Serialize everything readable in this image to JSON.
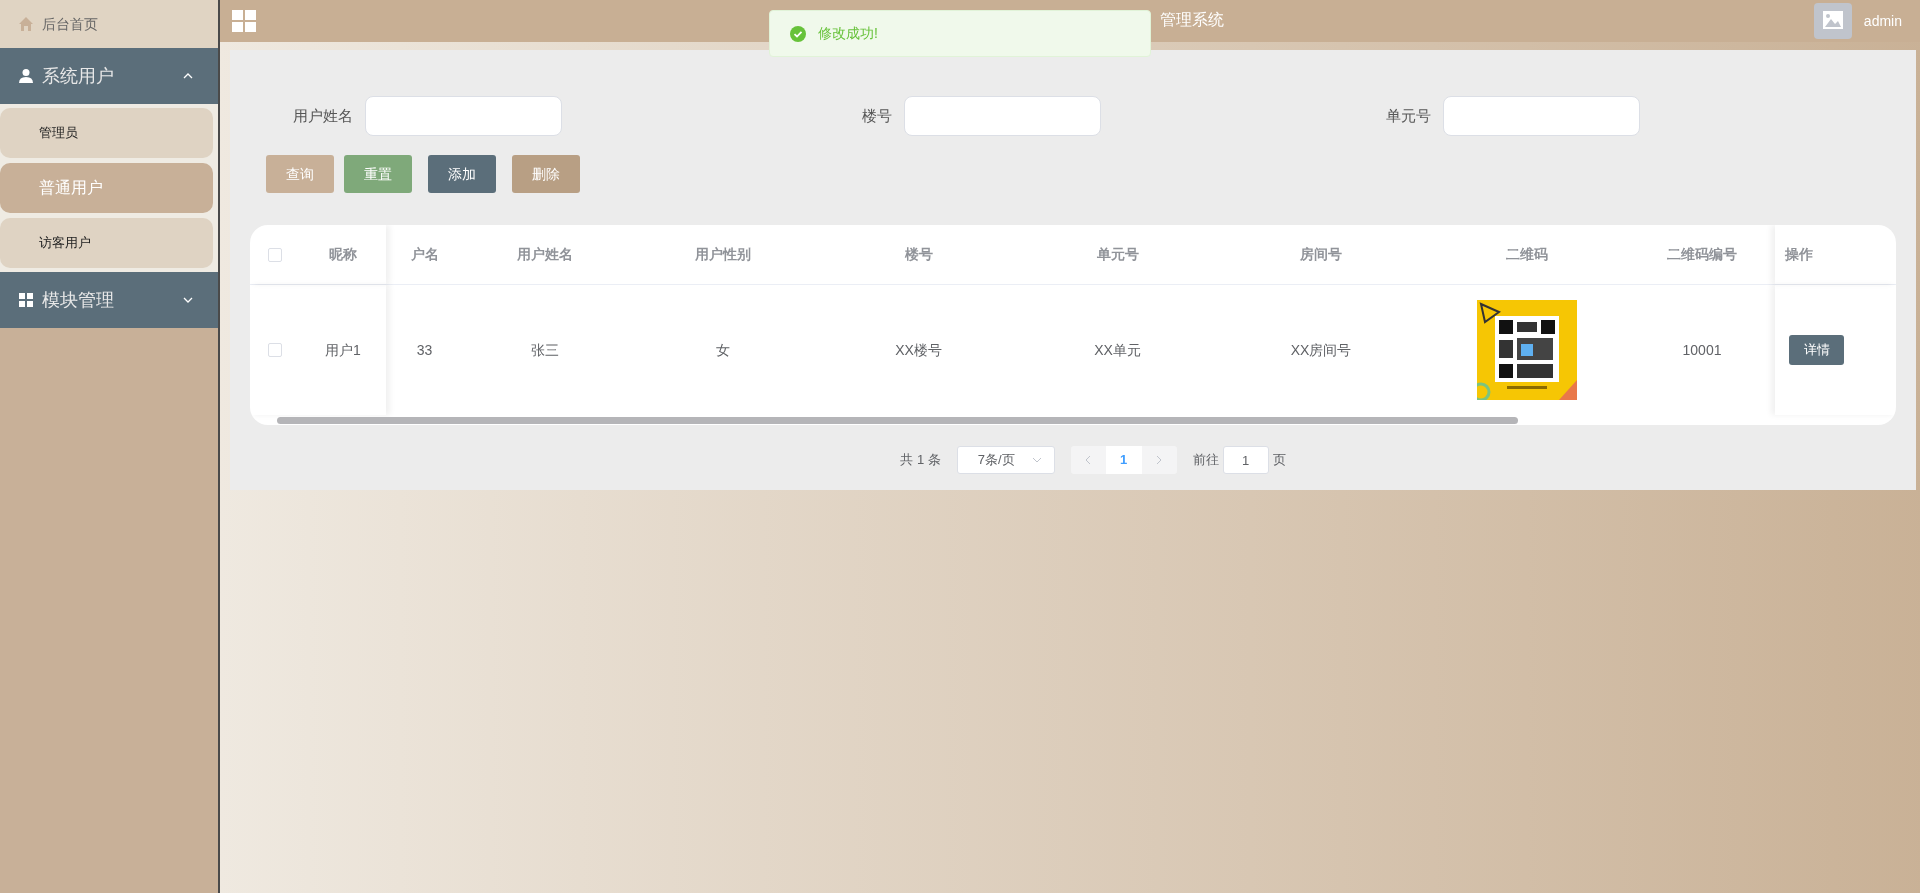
{
  "header": {
    "title": "管理系统",
    "user": "admin"
  },
  "toast": {
    "message": "修改成功!"
  },
  "sidebar": {
    "items": [
      {
        "label": "后台首页",
        "kind": "link"
      },
      {
        "label": "系统用户",
        "kind": "group",
        "expanded": true,
        "children": [
          {
            "label": "管理员",
            "selected": false
          },
          {
            "label": "普通用户",
            "selected": true
          },
          {
            "label": "访客用户",
            "selected": false
          }
        ]
      },
      {
        "label": "模块管理",
        "kind": "group",
        "expanded": false
      }
    ]
  },
  "filters": [
    {
      "label": "用户姓名"
    },
    {
      "label": "楼号"
    },
    {
      "label": "单元号"
    }
  ],
  "actions": [
    {
      "label": "查询",
      "kind": "query",
      "disabled": false
    },
    {
      "label": "重置",
      "kind": "reset",
      "disabled": false
    },
    {
      "label": "添加",
      "kind": "add",
      "disabled": false
    },
    {
      "label": "删除",
      "kind": "delete",
      "disabled": true
    }
  ],
  "table": {
    "all_checked": false,
    "columns": [
      "昵称",
      "户名",
      "用户姓名",
      "用户性别",
      "楼号",
      "单元号",
      "房间号",
      "二维码",
      "二维码编号",
      "操作"
    ],
    "rows": [
      {
        "checked": false,
        "cells": [
          "用户1",
          "33",
          "张三",
          "女",
          "XX楼号",
          "XX单元",
          "XX房间号",
          {
            "kind": "picture"
          },
          "10001"
        ],
        "action": "详情"
      }
    ]
  },
  "pagination": {
    "total": "共 1 条",
    "page_size": "7条/页",
    "pages": [
      {
        "label": "1",
        "selected": true
      }
    ],
    "goto_label": "前往",
    "goto_value": "1",
    "goto_suffix": "页"
  }
}
